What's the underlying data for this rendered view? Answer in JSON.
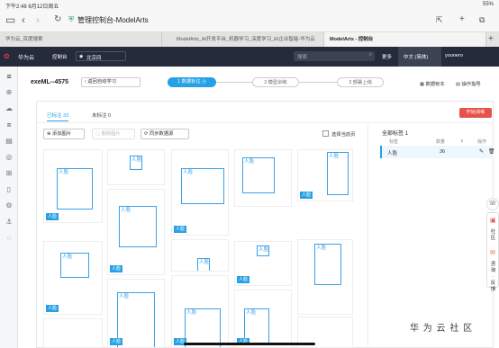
{
  "status": {
    "time_date": "下午2:48  6月12日周五",
    "battery": "55%"
  },
  "browser": {
    "page_title": "管理控制台-ModelArts",
    "tabs": [
      "华为云_百度搜索",
      "ModelArts_AI开发平台_机器学习_深度学习_EI企业智能-华为云",
      "ModelArts - 控制台"
    ]
  },
  "topbar": {
    "brand": "华为云",
    "console": "控制台",
    "region": "北京四",
    "search_placeholder": "搜索",
    "more": "更多",
    "lang": "中文 (简体)",
    "user": "younero"
  },
  "header": {
    "title": "exeML--4575",
    "back": "返回自动学习",
    "steps": [
      "1 数据标注",
      "2 模型训练",
      "3 部署上线"
    ],
    "links": [
      "数据帐本",
      "操作指导"
    ]
  },
  "toolbar": {
    "tab_labeled": "已标注 33",
    "tab_unlabeled": "未标注 0",
    "start_train": "开始训练",
    "add_image": "添加图片",
    "delete_image": "删除图片",
    "sync_source": "同步数据源",
    "select_page": "选择当前页"
  },
  "right_panel": {
    "title": "全部标签",
    "count": "1",
    "col_label": "标签",
    "col_qty": "数量",
    "col_ops": "操作",
    "row": {
      "name": "人脸",
      "qty": "36"
    }
  },
  "box_label": "人脸",
  "float": {
    "community": "社区",
    "consult": "咨询·反馈"
  },
  "watermark": "华 为 云 社 区",
  "colors": {
    "accent": "#26a1e5",
    "primary": "#e5534b",
    "topbar": "#252b3a"
  }
}
